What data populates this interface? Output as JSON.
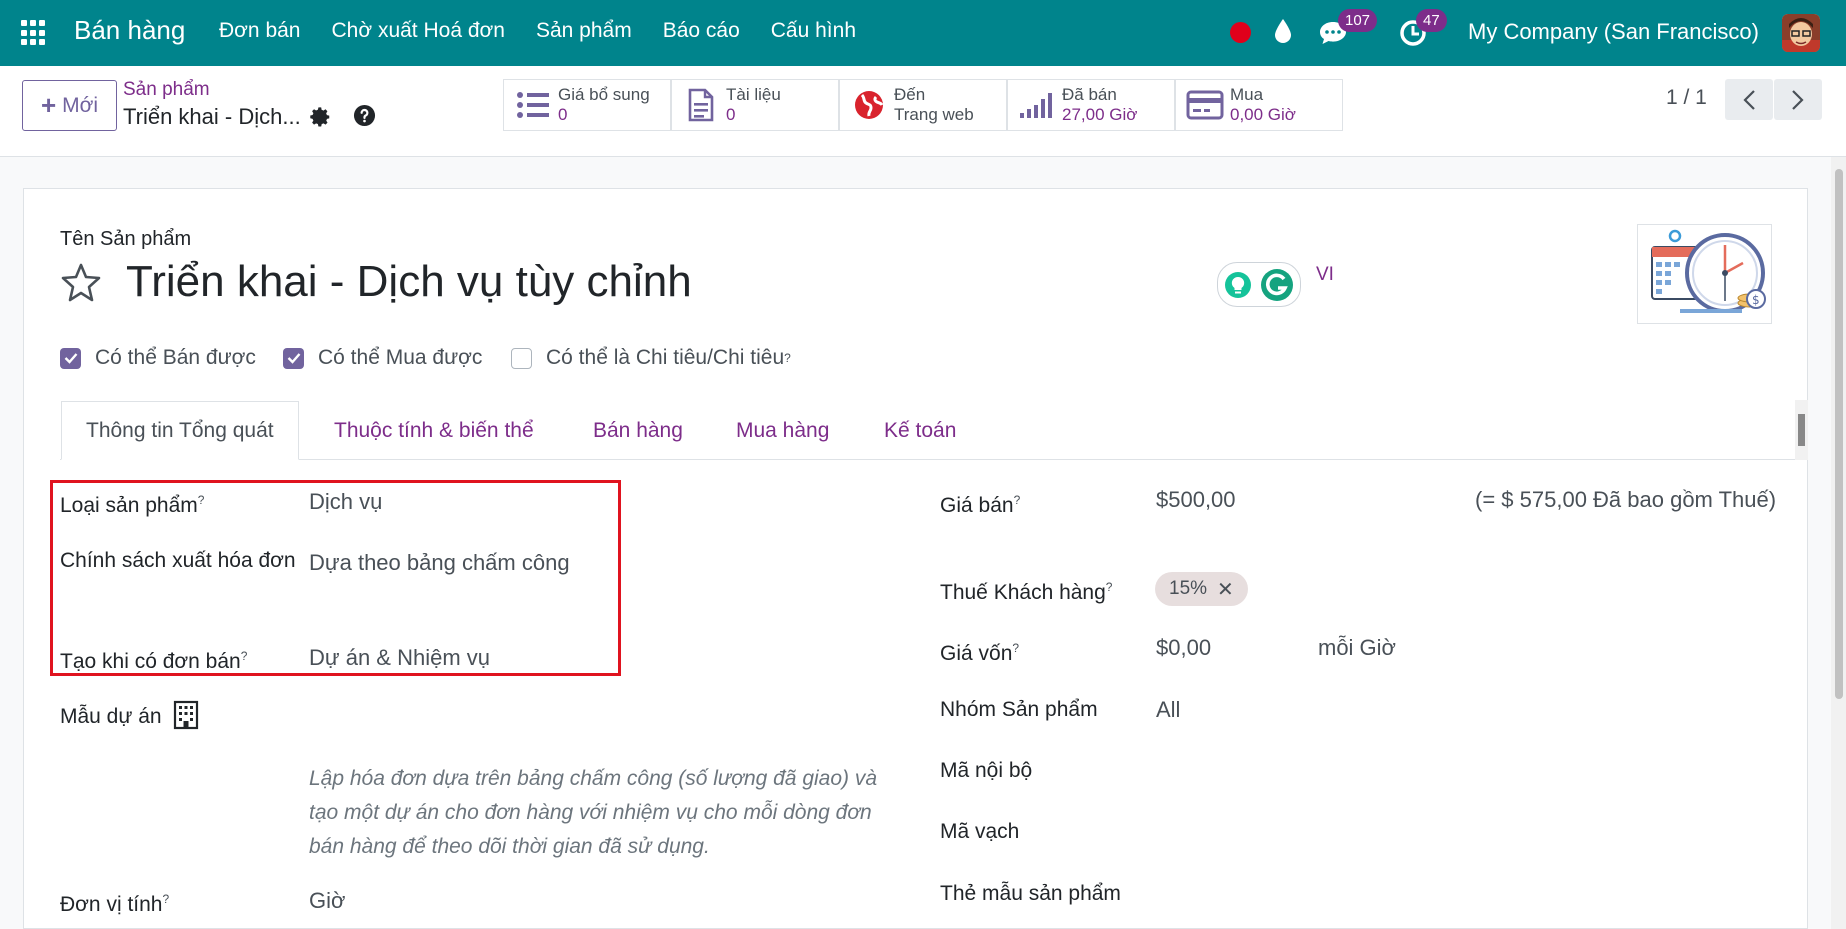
{
  "navbar": {
    "brand": "Bán hàng",
    "menu": [
      "Đơn bán",
      "Chờ xuất Hoá đơn",
      "Sản phẩm",
      "Báo cáo",
      "Cấu hình"
    ],
    "messages_count": "107",
    "activities_count": "47",
    "company": "My Company (San Francisco)",
    "colors": {
      "bar": "#00848c",
      "badge": "#7d2d8a",
      "record": "#e0001b"
    }
  },
  "control_panel": {
    "new_label": "Mới",
    "breadcrumb_parent": "Sản phẩm",
    "breadcrumb_current": "Triển khai - Dịch...",
    "smart_buttons": [
      {
        "label": "Giá bổ sung",
        "value": "0",
        "icon": "list-icon"
      },
      {
        "label": "Tài liệu",
        "value": "0",
        "icon": "document-icon"
      },
      {
        "label": "Đến",
        "value": "Trang web",
        "icon": "globe-icon"
      },
      {
        "label": "Đã bán",
        "value": "27,00 Giờ",
        "icon": "signal-icon"
      },
      {
        "label": "Mua",
        "value": "0,00 Giờ",
        "icon": "credit-card-icon"
      }
    ],
    "pager": "1 / 1"
  },
  "form": {
    "name_label": "Tên Sản phẩm",
    "product_name": "Triển khai - Dịch vụ tùy chỉnh",
    "lang_code": "VI",
    "checkboxes": [
      {
        "label": "Có thể Bán được",
        "checked": true
      },
      {
        "label": "Có thể Mua được",
        "checked": true
      },
      {
        "label": "Có thể là Chi tiêu/Chi tiêu",
        "checked": false,
        "help": "?"
      }
    ],
    "tabs": [
      "Thông tin Tổng quát",
      "Thuộc tính & biến thể",
      "Bán hàng",
      "Mua hàng",
      "Kế toán"
    ],
    "left_fields": {
      "product_type": {
        "label": "Loại sản phẩm",
        "value": "Dịch vụ"
      },
      "invoice_policy": {
        "label": "Chính sách xuất hóa đơn",
        "value": "Dựa theo bảng chấm công"
      },
      "create_on_order": {
        "label": "Tạo khi có đơn bán",
        "value": "Dự án & Nhiệm vụ"
      },
      "project_template": {
        "label": "Mẫu dự án"
      },
      "description": "Lập hóa đơn dựa trên bảng chấm công (số lượng đã giao) và tạo một dự án cho đơn hàng với nhiệm vụ cho mỗi dòng đơn bán hàng để theo dõi thời gian đã sử dụng.",
      "uom": {
        "label": "Đơn vị tính",
        "value": "Giờ"
      }
    },
    "right_fields": {
      "sale_price": {
        "label": "Giá bán",
        "value": "$500,00",
        "tax_incl": "(= $ 575,00 Đã bao gồm Thuế)"
      },
      "customer_tax": {
        "label": "Thuế Khách hàng",
        "tag": "15%"
      },
      "cost": {
        "label": "Giá vốn",
        "value": "$0,00",
        "per": "mỗi Giờ"
      },
      "category": {
        "label": "Nhóm Sản phẩm",
        "value": "All"
      },
      "internal_ref": {
        "label": "Mã nội bộ"
      },
      "barcode": {
        "label": "Mã vạch"
      },
      "product_tags": {
        "label": "Thẻ mẫu sản phẩm"
      }
    },
    "highlight_color": "#e0131f"
  }
}
